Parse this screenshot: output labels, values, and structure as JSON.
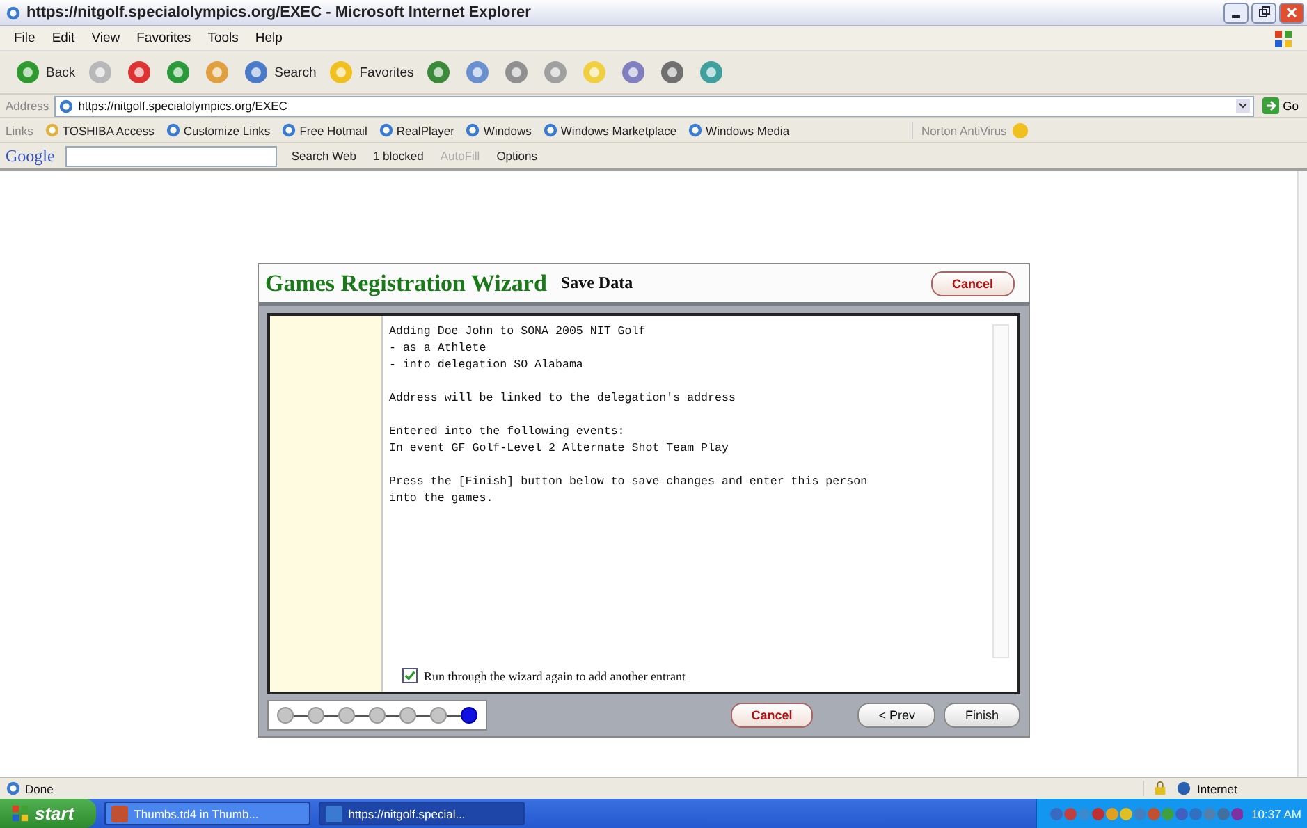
{
  "window": {
    "title": "https://nitgolf.specialolympics.org/EXEC - Microsoft Internet Explorer"
  },
  "menu": [
    "File",
    "Edit",
    "View",
    "Favorites",
    "Tools",
    "Help"
  ],
  "toolbar": [
    {
      "kind": "labeled",
      "label": "Back"
    },
    {
      "kind": "icon"
    },
    {
      "kind": "icon"
    },
    {
      "kind": "icon"
    },
    {
      "kind": "icon"
    },
    {
      "kind": "labeled",
      "label": "Search"
    },
    {
      "kind": "labeled",
      "label": "Favorites"
    },
    {
      "kind": "icon"
    },
    {
      "kind": "icon"
    },
    {
      "kind": "icon"
    },
    {
      "kind": "icon"
    },
    {
      "kind": "icon"
    },
    {
      "kind": "icon"
    },
    {
      "kind": "icon"
    },
    {
      "kind": "icon"
    }
  ],
  "address": {
    "label": "Address",
    "value": "https://nitgolf.specialolympics.org/EXEC",
    "go": "Go"
  },
  "links": {
    "label": "Links",
    "items": [
      "TOSHIBA Access",
      "Customize Links",
      "Free Hotmail",
      "RealPlayer",
      "Windows",
      "Windows Marketplace",
      "Windows Media"
    ],
    "norton": "Norton AntiVirus"
  },
  "google_bar": {
    "logo": "Google",
    "search": "Search Web",
    "blocked": "1 blocked",
    "autofill": "AutoFill",
    "options": "Options"
  },
  "wizard": {
    "title": "Games Registration Wizard",
    "subtitle": "Save Data",
    "top_button": "Cancel",
    "paragraphs": [
      [
        "Adding Doe John to SONA 2005 NIT Golf",
        "- as a Athlete",
        "- into delegation SO Alabama"
      ],
      [
        "Address will be linked to the delegation's address"
      ],
      [
        "Entered into the following events:",
        "In event GF Golf-Level 2 Alternate Shot Team Play"
      ],
      [
        "Press the [Finish] button below to save changes and enter this person",
        "into the games."
      ]
    ],
    "repeat": {
      "label": "Run through the wizard again to add another entrant",
      "checked": true
    },
    "steps": [
      {
        "selected": false
      },
      {
        "selected": false
      },
      {
        "selected": false
      },
      {
        "selected": false
      },
      {
        "selected": false
      },
      {
        "selected": false
      },
      {
        "selected": true
      }
    ],
    "buttons": [
      "Cancel",
      "< Prev",
      "Finish"
    ]
  },
  "status_bar": {
    "text": "Done",
    "zone": "Internet"
  },
  "taskbar": {
    "start": "start",
    "tasks": [
      {
        "label": "Thumbs.td4 in Thumb...",
        "selected": false
      },
      {
        "label": "https://nitgolf.special...",
        "selected": true
      }
    ],
    "clock": "10:37 AM"
  }
}
